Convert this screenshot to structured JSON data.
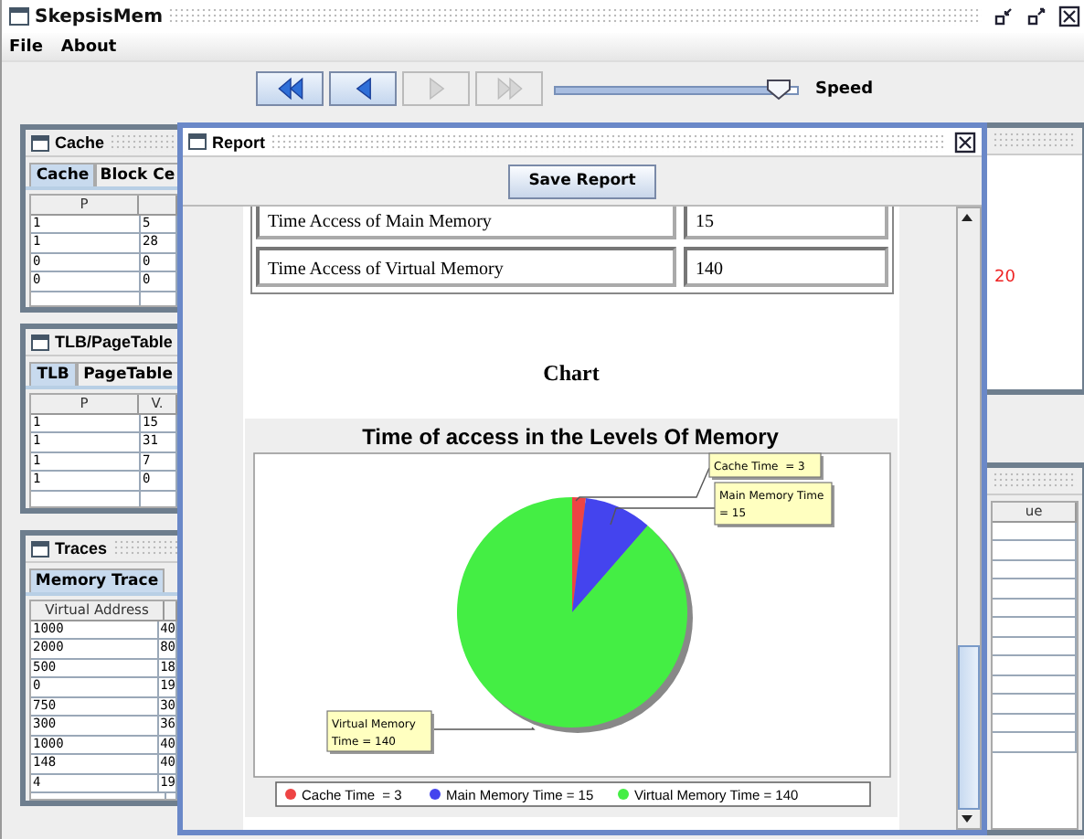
{
  "window": {
    "title": "SkepsisMem"
  },
  "menu": [
    {
      "label": "File"
    },
    {
      "label": "About"
    }
  ],
  "toolbar": {
    "buttons": [
      {
        "kind": "rewind",
        "disabled": false
      },
      {
        "kind": "back",
        "disabled": false
      },
      {
        "kind": "play",
        "disabled": true
      },
      {
        "kind": "forward",
        "disabled": true
      }
    ],
    "speed": {
      "level": 0.92,
      "label": "Speed"
    }
  },
  "cache_window": {
    "title": "Cache",
    "tabs": [
      {
        "label": "Cache",
        "selected": true
      },
      {
        "label": "Block Ce",
        "selected": false
      }
    ],
    "columns": [
      "P"
    ],
    "rows": [
      [
        "1",
        "5"
      ],
      [
        "1",
        "28"
      ],
      [
        "0",
        "0"
      ],
      [
        "0",
        "0"
      ]
    ]
  },
  "tlb_window": {
    "title": "TLB/PageTable",
    "tabs": [
      {
        "label": "TLB",
        "selected": true
      },
      {
        "label": "PageTable",
        "selected": false
      }
    ],
    "columns": [
      "P",
      "V."
    ],
    "rows": [
      [
        "1",
        "15"
      ],
      [
        "1",
        "31"
      ],
      [
        "1",
        "7"
      ],
      [
        "1",
        "0"
      ]
    ]
  },
  "traces_window": {
    "title": "Traces",
    "tabs": [
      {
        "label": "Memory Trace",
        "selected": true
      }
    ],
    "columns": [
      "Virtual Address"
    ],
    "rows": [
      [
        "1000",
        "40"
      ],
      [
        "2000",
        "80"
      ],
      [
        "500",
        "18"
      ],
      [
        "0",
        "19"
      ],
      [
        "750",
        "30"
      ],
      [
        "300",
        "36"
      ],
      [
        "1000",
        "40"
      ],
      [
        "148",
        "40"
      ],
      [
        "4",
        "19"
      ]
    ]
  },
  "counter_window": {
    "value": "20"
  },
  "values_window": {
    "columns": [
      "ue"
    ]
  },
  "report": {
    "title": "Report",
    "save_button": "Save Report",
    "rows": [
      {
        "label": "Time Access of Main Memory",
        "value": "15"
      },
      {
        "label": "Time Access of Virtual Memory",
        "value": "140"
      }
    ],
    "heading": "Chart",
    "chart": {
      "chart_data": {
        "type": "pie",
        "title": "Time of access in the Levels Of Memory",
        "categories": [
          "Cache Time  = 3",
          "Main Memory Time = 15",
          "Virtual Memory Time = 140"
        ],
        "values": [
          3,
          15,
          140
        ],
        "colors": [
          "#ee4444",
          "#4444ee",
          "#44ee44"
        ],
        "legend": "bottom"
      },
      "labels": [
        [
          "Cache Time  = 3"
        ],
        [
          "Main Memory Time",
          "= 15"
        ],
        [
          "Virtual Memory",
          "Time = 140"
        ]
      ]
    }
  }
}
